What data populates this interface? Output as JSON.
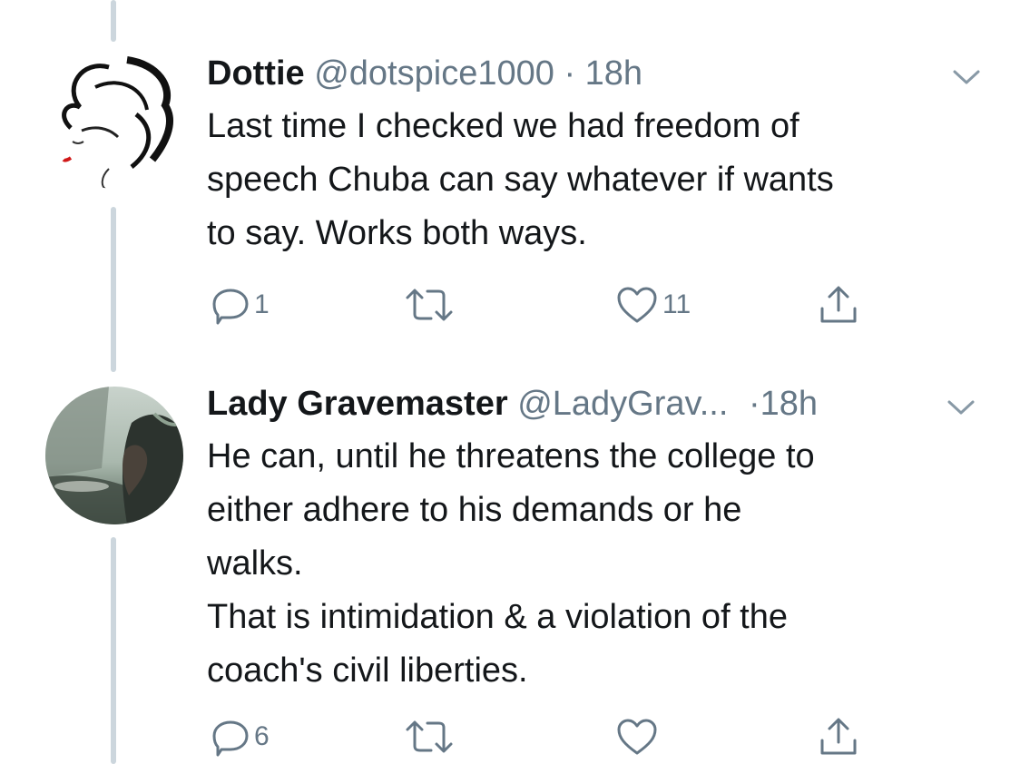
{
  "tweets": [
    {
      "name": "Dottie",
      "handle": "@dotspice1000",
      "separator": "·",
      "time": "18h",
      "text_lines": [
        "Last time I checked we had freedom of",
        "speech Chuba can say whatever if wants",
        "to say. Works both ways."
      ],
      "actions": {
        "reply_count": "1",
        "retweet_count": "",
        "like_count": "11"
      }
    },
    {
      "name": "Lady Gravemaster",
      "handle": "@LadyGrav...",
      "separator": "·",
      "time": "18h",
      "text_lines": [
        "He can, until he threatens the college to",
        "either adhere to his demands or he",
        "walks.",
        "That is intimidation & a violation of the",
        "coach's civil liberties."
      ],
      "actions": {
        "reply_count": "6",
        "retweet_count": "",
        "like_count": ""
      }
    }
  ],
  "icons": {
    "reply": "reply-icon",
    "retweet": "retweet-icon",
    "like": "heart-icon",
    "share": "share-icon",
    "caret": "chevron-down-icon"
  },
  "colors": {
    "text": "#14171a",
    "secondary": "#657786",
    "thread_line": "#ccd6dd",
    "background": "#ffffff"
  }
}
